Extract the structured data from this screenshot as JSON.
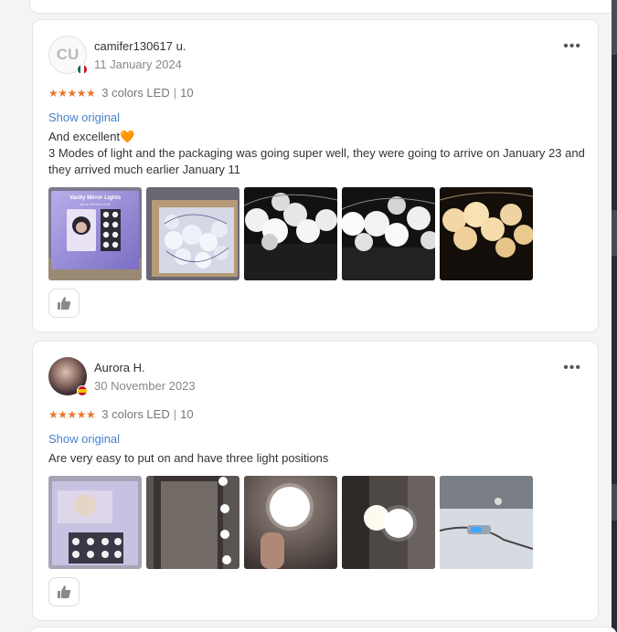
{
  "reviews": [
    {
      "avatar_initials": "CU",
      "country_flag": "flag-mexico",
      "name": "camifer130617 u.",
      "date": "11 January 2024",
      "stars": "★★★★★",
      "rating": 5,
      "variant": "3 colors LED",
      "quantity": "10",
      "show_original": "Show original",
      "text_line1": "And excellent🧡",
      "text_line2": "3 Modes of light and the packaging was going super well, they were going to arrive on January 23 and they arrived much earlier January 11",
      "photo_count": 5
    },
    {
      "avatar_initials": "",
      "country_flag": "flag-spain",
      "name": "Aurora H.",
      "date": "30 November 2023",
      "stars": "★★★★★",
      "rating": 5,
      "variant": "3 colors LED",
      "quantity": "10",
      "show_original": "Show original",
      "text_line1": "Are very easy to put on and have three light positions",
      "photo_count": 5
    }
  ],
  "package_box": {
    "title": "Vanity Mirror Lights",
    "subtitle": "Must Efficient Soft"
  },
  "icons": {
    "more": "more-options-icon",
    "like": "thumbs-up-icon"
  },
  "colors": {
    "star": "#e9772c",
    "link": "#4a80c8",
    "card_border": "#e6e6ea"
  }
}
